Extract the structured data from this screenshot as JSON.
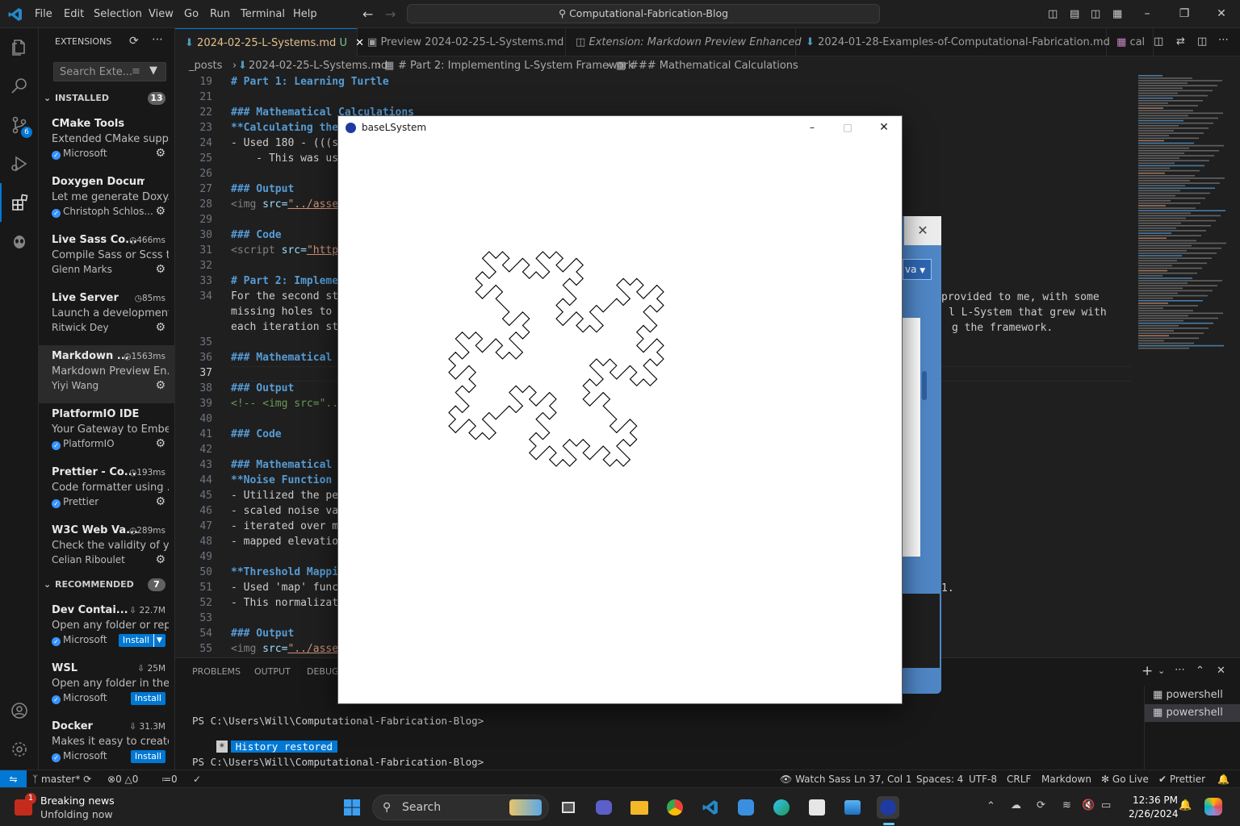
{
  "title_bar": {
    "menus": [
      "File",
      "Edit",
      "Selection",
      "View",
      "Go",
      "Run",
      "Terminal",
      "Help"
    ],
    "search_text": "Computational-Fabrication-Blog"
  },
  "sidebar": {
    "header": "EXTENSIONS",
    "search_placeholder": "Search Exte...",
    "installed_label": "INSTALLED",
    "installed_count": "13",
    "installed": [
      {
        "name": "CMake Tools",
        "desc": "Extended CMake supp...",
        "publisher": "Microsoft",
        "verified": true,
        "meta": ""
      },
      {
        "name": "Doxygen Documenta...",
        "desc": "Let me generate Doxy...",
        "publisher": "Christoph Schlos...",
        "verified": true,
        "meta": ""
      },
      {
        "name": "Live Sass Co...",
        "desc": "Compile Sass or Scss t...",
        "publisher": "Glenn Marks",
        "verified": false,
        "meta": "466ms"
      },
      {
        "name": "Live Server",
        "desc": "Launch a development...",
        "publisher": "Ritwick Dey",
        "verified": false,
        "meta": "85ms"
      },
      {
        "name": "Markdown ...",
        "desc": "Markdown Preview En...",
        "publisher": "Yiyi Wang",
        "verified": false,
        "meta": "1563ms"
      },
      {
        "name": "PlatformIO IDE",
        "desc": "Your Gateway to Embe...",
        "publisher": "PlatformIO",
        "verified": true,
        "meta": ""
      },
      {
        "name": "Prettier - Co...",
        "desc": "Code formatter using ...",
        "publisher": "Prettier",
        "verified": true,
        "meta": "193ms"
      },
      {
        "name": "W3C Web Va...",
        "desc": "Check the validity of y...",
        "publisher": "Celian Riboulet",
        "verified": false,
        "meta": "289ms"
      }
    ],
    "recommended_label": "RECOMMENDED",
    "recommended_count": "7",
    "recommended": [
      {
        "name": "Dev Contai...",
        "desc": "Open any folder or rep...",
        "publisher": "Microsoft",
        "meta": "22.7M",
        "install": "Install"
      },
      {
        "name": "WSL",
        "desc": "Open any folder in the...",
        "publisher": "Microsoft",
        "meta": "25M",
        "install": "Install"
      },
      {
        "name": "Docker",
        "desc": "Makes it easy to create...",
        "publisher": "Microsoft",
        "meta": "31.3M",
        "install": "Install"
      }
    ]
  },
  "tabs": [
    {
      "label": "2024-02-25-L-Systems.md",
      "suffix": "U"
    },
    {
      "label": "Preview 2024-02-25-L-Systems.md",
      "suffix": ""
    },
    {
      "label": "Extension: Markdown Preview Enhanced",
      "suffix": ""
    },
    {
      "label": "2024-01-28-Examples-of-Computational-Fabrication.md",
      "suffix": ""
    },
    {
      "label": "cal",
      "suffix": ""
    }
  ],
  "breadcrumb": [
    "_posts",
    "2024-02-25-L-Systems.md",
    "# Part 2: Implementing L-System Framework",
    "### Mathematical Calculations"
  ],
  "editor_lines": [
    {
      "n": "19",
      "t": "# Part 1: Learning Turtle",
      "k": "head"
    },
    {
      "n": "21",
      "t": "",
      "k": ""
    },
    {
      "n": "22",
      "t": "### Mathematical Calculations",
      "k": "head"
    },
    {
      "n": "23",
      "t": "**Calculating the",
      "k": "bold"
    },
    {
      "n": "24",
      "t": "- Used 180 - (((s",
      "k": ""
    },
    {
      "n": "25",
      "t": "    - This was us",
      "k": ""
    },
    {
      "n": "26",
      "t": "",
      "k": ""
    },
    {
      "n": "27",
      "t": "### Output",
      "k": "head"
    },
    {
      "n": "28",
      "t": "<img src=\"../asse",
      "k": "img"
    },
    {
      "n": "29",
      "t": "",
      "k": ""
    },
    {
      "n": "30",
      "t": "### Code",
      "k": "head"
    },
    {
      "n": "31",
      "t": "<script src=\"http",
      "k": "script"
    },
    {
      "n": "32",
      "t": "",
      "k": ""
    },
    {
      "n": "33",
      "t": "# Part 2: Impleme",
      "k": "head"
    },
    {
      "n": "34",
      "t": "For the second st",
      "k": ""
    },
    {
      "n": "",
      "t": "missing holes to",
      "k": ""
    },
    {
      "n": "",
      "t": "each iteration st",
      "k": ""
    },
    {
      "n": "35",
      "t": "",
      "k": ""
    },
    {
      "n": "36",
      "t": "### Mathematical",
      "k": "head"
    },
    {
      "n": "37",
      "t": "",
      "k": "cur"
    },
    {
      "n": "38",
      "t": "### Output",
      "k": "head"
    },
    {
      "n": "39",
      "t": "<!-- <img src=\"..",
      "k": "comment"
    },
    {
      "n": "40",
      "t": "",
      "k": ""
    },
    {
      "n": "41",
      "t": "### Code",
      "k": "head"
    },
    {
      "n": "42",
      "t": "",
      "k": ""
    },
    {
      "n": "43",
      "t": "### Mathematical",
      "k": "head"
    },
    {
      "n": "44",
      "t": "**Noise Function",
      "k": "bold"
    },
    {
      "n": "45",
      "t": "- Utilized the pe",
      "k": ""
    },
    {
      "n": "46",
      "t": "- scaled noise va",
      "k": ""
    },
    {
      "n": "47",
      "t": "- iterated over m",
      "k": ""
    },
    {
      "n": "48",
      "t": "- mapped elevatio",
      "k": ""
    },
    {
      "n": "49",
      "t": "",
      "k": ""
    },
    {
      "n": "50",
      "t": "**Threshold Mappi",
      "k": "bold"
    },
    {
      "n": "51",
      "t": "- Used 'map' func",
      "k": ""
    },
    {
      "n": "52",
      "t": "- This normalizat",
      "k": ""
    },
    {
      "n": "53",
      "t": "",
      "k": ""
    },
    {
      "n": "54",
      "t": "### Output",
      "k": "head"
    },
    {
      "n": "55",
      "t": "<img src=\"../asse",
      "k": "img"
    }
  ],
  "editor_right_fragments": {
    "line34a": "provided to me, with some",
    "line34b": "l L-System that grew with",
    "line34c": "g the framework.",
    "line51": "1."
  },
  "panel": {
    "tabs": [
      "PROBLEMS",
      "OUTPUT",
      "DEBUG"
    ],
    "prompt1": "PS C:\\Users\\Will\\Computational-Fabrication-Blog>",
    "history": "History restored",
    "prompt2": "PS C:\\Users\\Will\\Computational-Fabrication-Blog>",
    "terminals": [
      "powershell",
      "powershell"
    ]
  },
  "statusbar": {
    "branch": "master*",
    "errors": "0",
    "warnings": "0",
    "ports": "0",
    "watch_sass": "Watch Sass",
    "position": "Ln 37, Col 1",
    "spaces": "Spaces: 4",
    "encoding": "UTF-8",
    "eol": "CRLF",
    "language": "Markdown",
    "golive": "Go Live",
    "prettier": "Prettier"
  },
  "sketch_window": {
    "title": "baseLSystem"
  },
  "bg_window": {
    "dropdown_text": "va"
  },
  "taskbar": {
    "news_title": "Breaking news",
    "news_sub": "Unfolding now",
    "news_badge": "1",
    "search_label": "Search",
    "time": "12:36 PM",
    "date": "2/26/2024"
  },
  "colors": {
    "accent": "#0078d4",
    "sketch_line": "#000000"
  }
}
